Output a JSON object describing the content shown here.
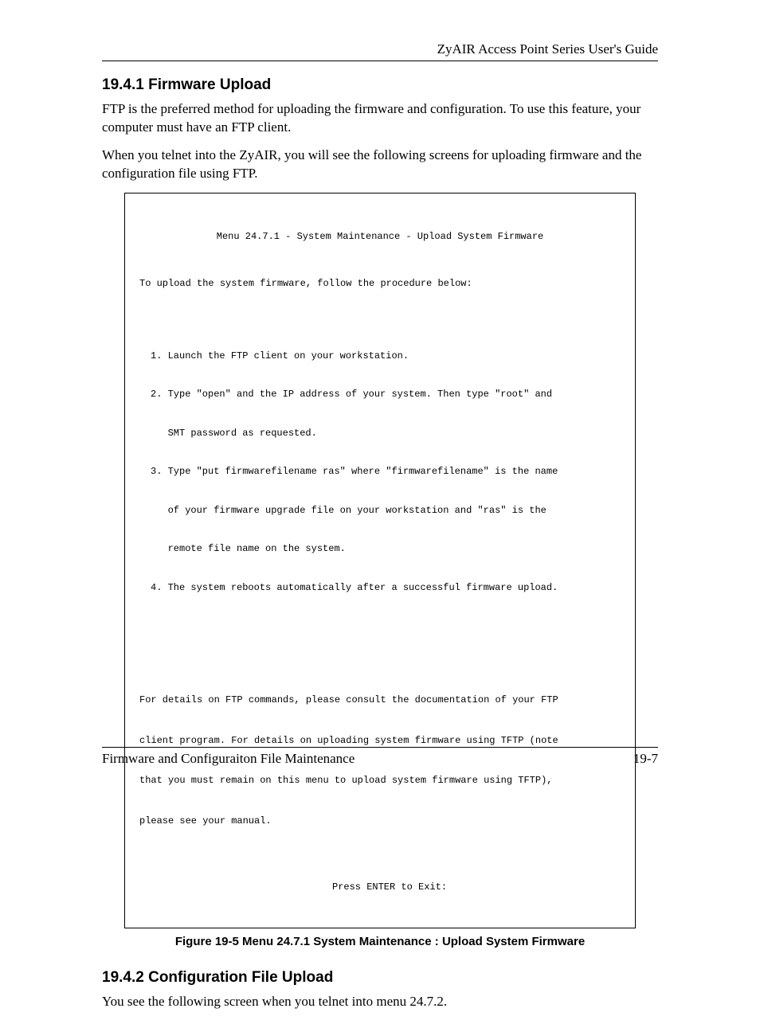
{
  "header": {
    "title": "ZyAIR Access Point Series User's Guide"
  },
  "section1": {
    "heading": "19.4.1 Firmware Upload",
    "para1": "FTP is the preferred method for uploading the firmware and configuration. To use this feature, your computer must have an FTP client.",
    "para2": "When you telnet into the ZyAIR, you will see the following screens for uploading firmware and the configuration file using FTP."
  },
  "terminal": {
    "title": "Menu 24.7.1 - System Maintenance - Upload System Firmware",
    "intro": "To upload the system firmware, follow the procedure below:",
    "step1": "1. Launch the FTP client on your workstation.",
    "step2a": "2. Type \"open\" and the IP address of your system. Then type \"root\" and",
    "step2b": "   SMT password as requested.",
    "step3a": "3. Type \"put firmwarefilename ras\" where \"firmwarefilename\" is the name",
    "step3b": "   of your firmware upgrade file on your workstation and \"ras\" is the",
    "step3c": "   remote file name on the system.",
    "step4": "4. The system reboots automatically after a successful firmware upload.",
    "note1": "For details on FTP commands, please consult the documentation of your FTP",
    "note2": "client program. For details on uploading system firmware using TFTP (note",
    "note3": "that you must remain on this menu to upload system firmware using TFTP),",
    "note4": "please see your manual.",
    "exit": "Press ENTER to Exit:"
  },
  "figure_caption": "Figure 19-5 Menu 24.7.1 System Maintenance : Upload System Firmware",
  "section2": {
    "heading": "19.4.2 Configuration File Upload",
    "para1": "You see the following screen when you telnet into menu 24.7.2."
  },
  "footer": {
    "left": "Firmware and Configuraiton File Maintenance",
    "right": "19-7"
  }
}
